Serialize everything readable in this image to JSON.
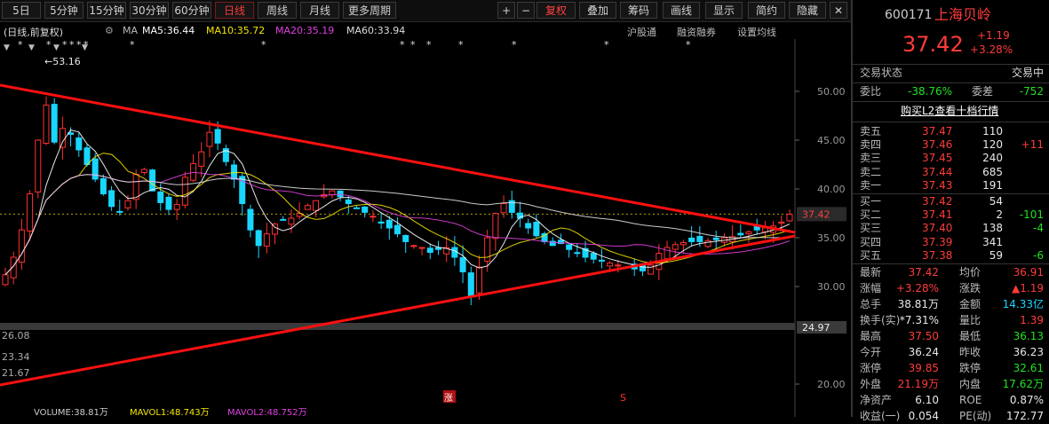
{
  "toolbar": {
    "periods": [
      "5日",
      "5分钟",
      "15分钟",
      "30分钟",
      "60分钟",
      "日线",
      "周线",
      "月线",
      "更多周期"
    ],
    "active_period": "日线",
    "plus": "+",
    "minus": "−",
    "right_buttons": [
      "复权",
      "叠加",
      "筹码",
      "画线",
      "显示",
      "简约",
      "隐藏"
    ],
    "close": "✕"
  },
  "info": {
    "title": "(日线,前复权)",
    "ma5": "MA5:36.44",
    "ma10": "MA10:35.72",
    "ma20": "MA20:35.19",
    "ma60": "MA60:33.94",
    "links": [
      "沪股通",
      "融资融券",
      "设置均线"
    ]
  },
  "colors": {
    "ma5": "#ffffff",
    "ma10": "#f5e600",
    "ma20": "#e040e0",
    "ma60": "#e0e0e0",
    "trend": "#ff1010",
    "up": "#ff3030",
    "down": "#19d6ff"
  },
  "chart_data": {
    "type": "candlestick",
    "y_ticks": [
      "50.00",
      "45.00",
      "40.00",
      "35.00",
      "30.00",
      "20.00"
    ],
    "current_price_label": "37.42",
    "support_label": "24.97",
    "high_marker": "53.16",
    "left_labels": [
      "26.08",
      "23.34",
      "21.67"
    ],
    "markers": [
      "涨",
      "S"
    ],
    "close_series": [
      31.2,
      33.0,
      35.8,
      39.5,
      45.0,
      48.6,
      44.8,
      46.2,
      45.6,
      44.0,
      42.5,
      41.0,
      39.5,
      38.2,
      37.6,
      38.8,
      41.5,
      42.0,
      39.8,
      38.6,
      37.9,
      38.4,
      41.2,
      42.6,
      43.8,
      45.8,
      44.7,
      42.8,
      41.0,
      38.5,
      35.8,
      34.2,
      35.4,
      36.4,
      36.8,
      37.0,
      37.5,
      38.3,
      38.8,
      39.4,
      39.8,
      39.2,
      38.5,
      38.0,
      37.6,
      37.2,
      36.5,
      36.0,
      35.4,
      34.6,
      34.2,
      34.0,
      33.5,
      33.8,
      34.0,
      33.0,
      31.5,
      29.0,
      32.0,
      35.0,
      37.5,
      38.5,
      37.6,
      37.0,
      36.0,
      35.2,
      34.6,
      34.2,
      34.4,
      33.8,
      33.4,
      33.0,
      32.8,
      32.6,
      32.4,
      32.2,
      32.0,
      31.8,
      31.6,
      32.2,
      33.4,
      34.0,
      34.3,
      34.5,
      34.6,
      34.6,
      34.7,
      34.8,
      35.0,
      35.1,
      35.3,
      35.6,
      35.8,
      36.0,
      36.2,
      36.6,
      37.4
    ],
    "price_range": [
      19,
      55
    ],
    "ma5_last": 36.44,
    "ma10_last": 35.72,
    "ma20_last": 35.19,
    "ma60_last": 33.94,
    "volume_label": "VOLUME:38.81万",
    "mavol1": "MAVOL1:48.743万",
    "mavol2": "MAVOL2:48.752万"
  },
  "panel": {
    "code": "600171",
    "name": "上海贝岭",
    "price": "37.42",
    "change": "+1.19",
    "change_pct": "+3.28%",
    "status_label": "交易状态",
    "status_value": "交易中",
    "weibi_label": "委比",
    "weibi_value": "-38.76%",
    "weicha_label": "委差",
    "weicha_value": "-752",
    "l2_link": "购买L2查看十档行情",
    "sells": [
      {
        "label": "卖五",
        "price": "37.47",
        "vol": "110",
        "delta": ""
      },
      {
        "label": "卖四",
        "price": "37.46",
        "vol": "120",
        "delta": "+11"
      },
      {
        "label": "卖三",
        "price": "37.45",
        "vol": "240",
        "delta": ""
      },
      {
        "label": "卖二",
        "price": "37.44",
        "vol": "685",
        "delta": ""
      },
      {
        "label": "卖一",
        "price": "37.43",
        "vol": "191",
        "delta": ""
      }
    ],
    "buys": [
      {
        "label": "买一",
        "price": "37.42",
        "vol": "54",
        "delta": ""
      },
      {
        "label": "买二",
        "price": "37.41",
        "vol": "2",
        "delta": "-101"
      },
      {
        "label": "买三",
        "price": "37.40",
        "vol": "138",
        "delta": "-4"
      },
      {
        "label": "买四",
        "price": "37.39",
        "vol": "341",
        "delta": ""
      },
      {
        "label": "买五",
        "price": "37.38",
        "vol": "59",
        "delta": "-6"
      }
    ],
    "stats": [
      {
        "l1": "最新",
        "v1": "37.42",
        "c1": "red",
        "l2": "均价",
        "v2": "36.91",
        "c2": "red"
      },
      {
        "l1": "涨幅",
        "v1": "+3.28%",
        "c1": "red",
        "l2": "涨跌",
        "v2": "▲1.19",
        "c2": "red"
      },
      {
        "l1": "总手",
        "v1": "38.81万",
        "c1": "white",
        "l2": "金额",
        "v2": "14.33亿",
        "c2": "cyan"
      },
      {
        "l1": "换手(实)",
        "v1": "*7.31%",
        "c1": "white",
        "l2": "量比",
        "v2": "1.39",
        "c2": "red"
      },
      {
        "l1": "最高",
        "v1": "37.50",
        "c1": "red",
        "l2": "最低",
        "v2": "36.13",
        "c2": "green"
      },
      {
        "l1": "今开",
        "v1": "36.24",
        "c1": "white",
        "l2": "昨收",
        "v2": "36.23",
        "c2": "white"
      },
      {
        "l1": "涨停",
        "v1": "39.85",
        "c1": "red",
        "l2": "跌停",
        "v2": "32.61",
        "c2": "green"
      },
      {
        "l1": "外盘",
        "v1": "21.19万",
        "c1": "red",
        "l2": "内盘",
        "v2": "17.62万",
        "c2": "green"
      },
      {
        "l1": "净资产",
        "v1": "6.10",
        "c1": "white",
        "l2": "ROE",
        "v2": "0.87%",
        "c2": "white"
      },
      {
        "l1": "收益(一)",
        "v1": "0.054",
        "c1": "white",
        "l2": "PE(动)",
        "v2": "172.77",
        "c2": "white"
      }
    ]
  }
}
